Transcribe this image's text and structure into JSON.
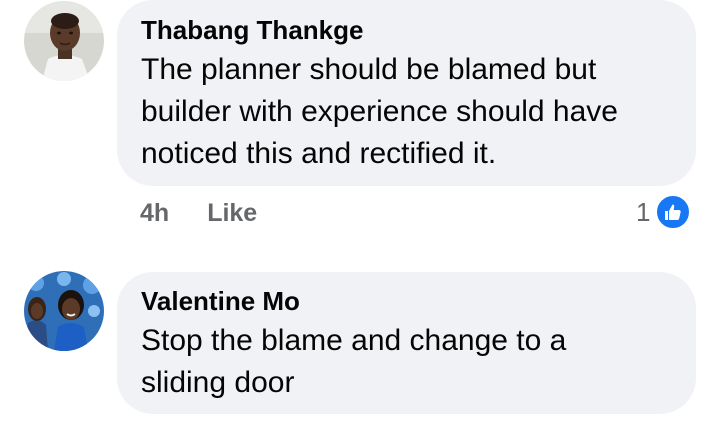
{
  "comments": [
    {
      "author": "Thabang Thankge",
      "text": "The planner should be blamed but\nbuilder with experience should have\nnoticed this and rectified it.",
      "time": "4h",
      "like_label": "Like",
      "reaction_count": "1",
      "reaction_icon": "like-thumb-icon"
    },
    {
      "author": "Valentine Mo",
      "text": "Stop the blame and change to a\nsliding door"
    }
  ],
  "colors": {
    "bubble": "#f0f2f5",
    "text": "#050505",
    "meta": "#65676b",
    "like_blue": "#1877f2"
  }
}
